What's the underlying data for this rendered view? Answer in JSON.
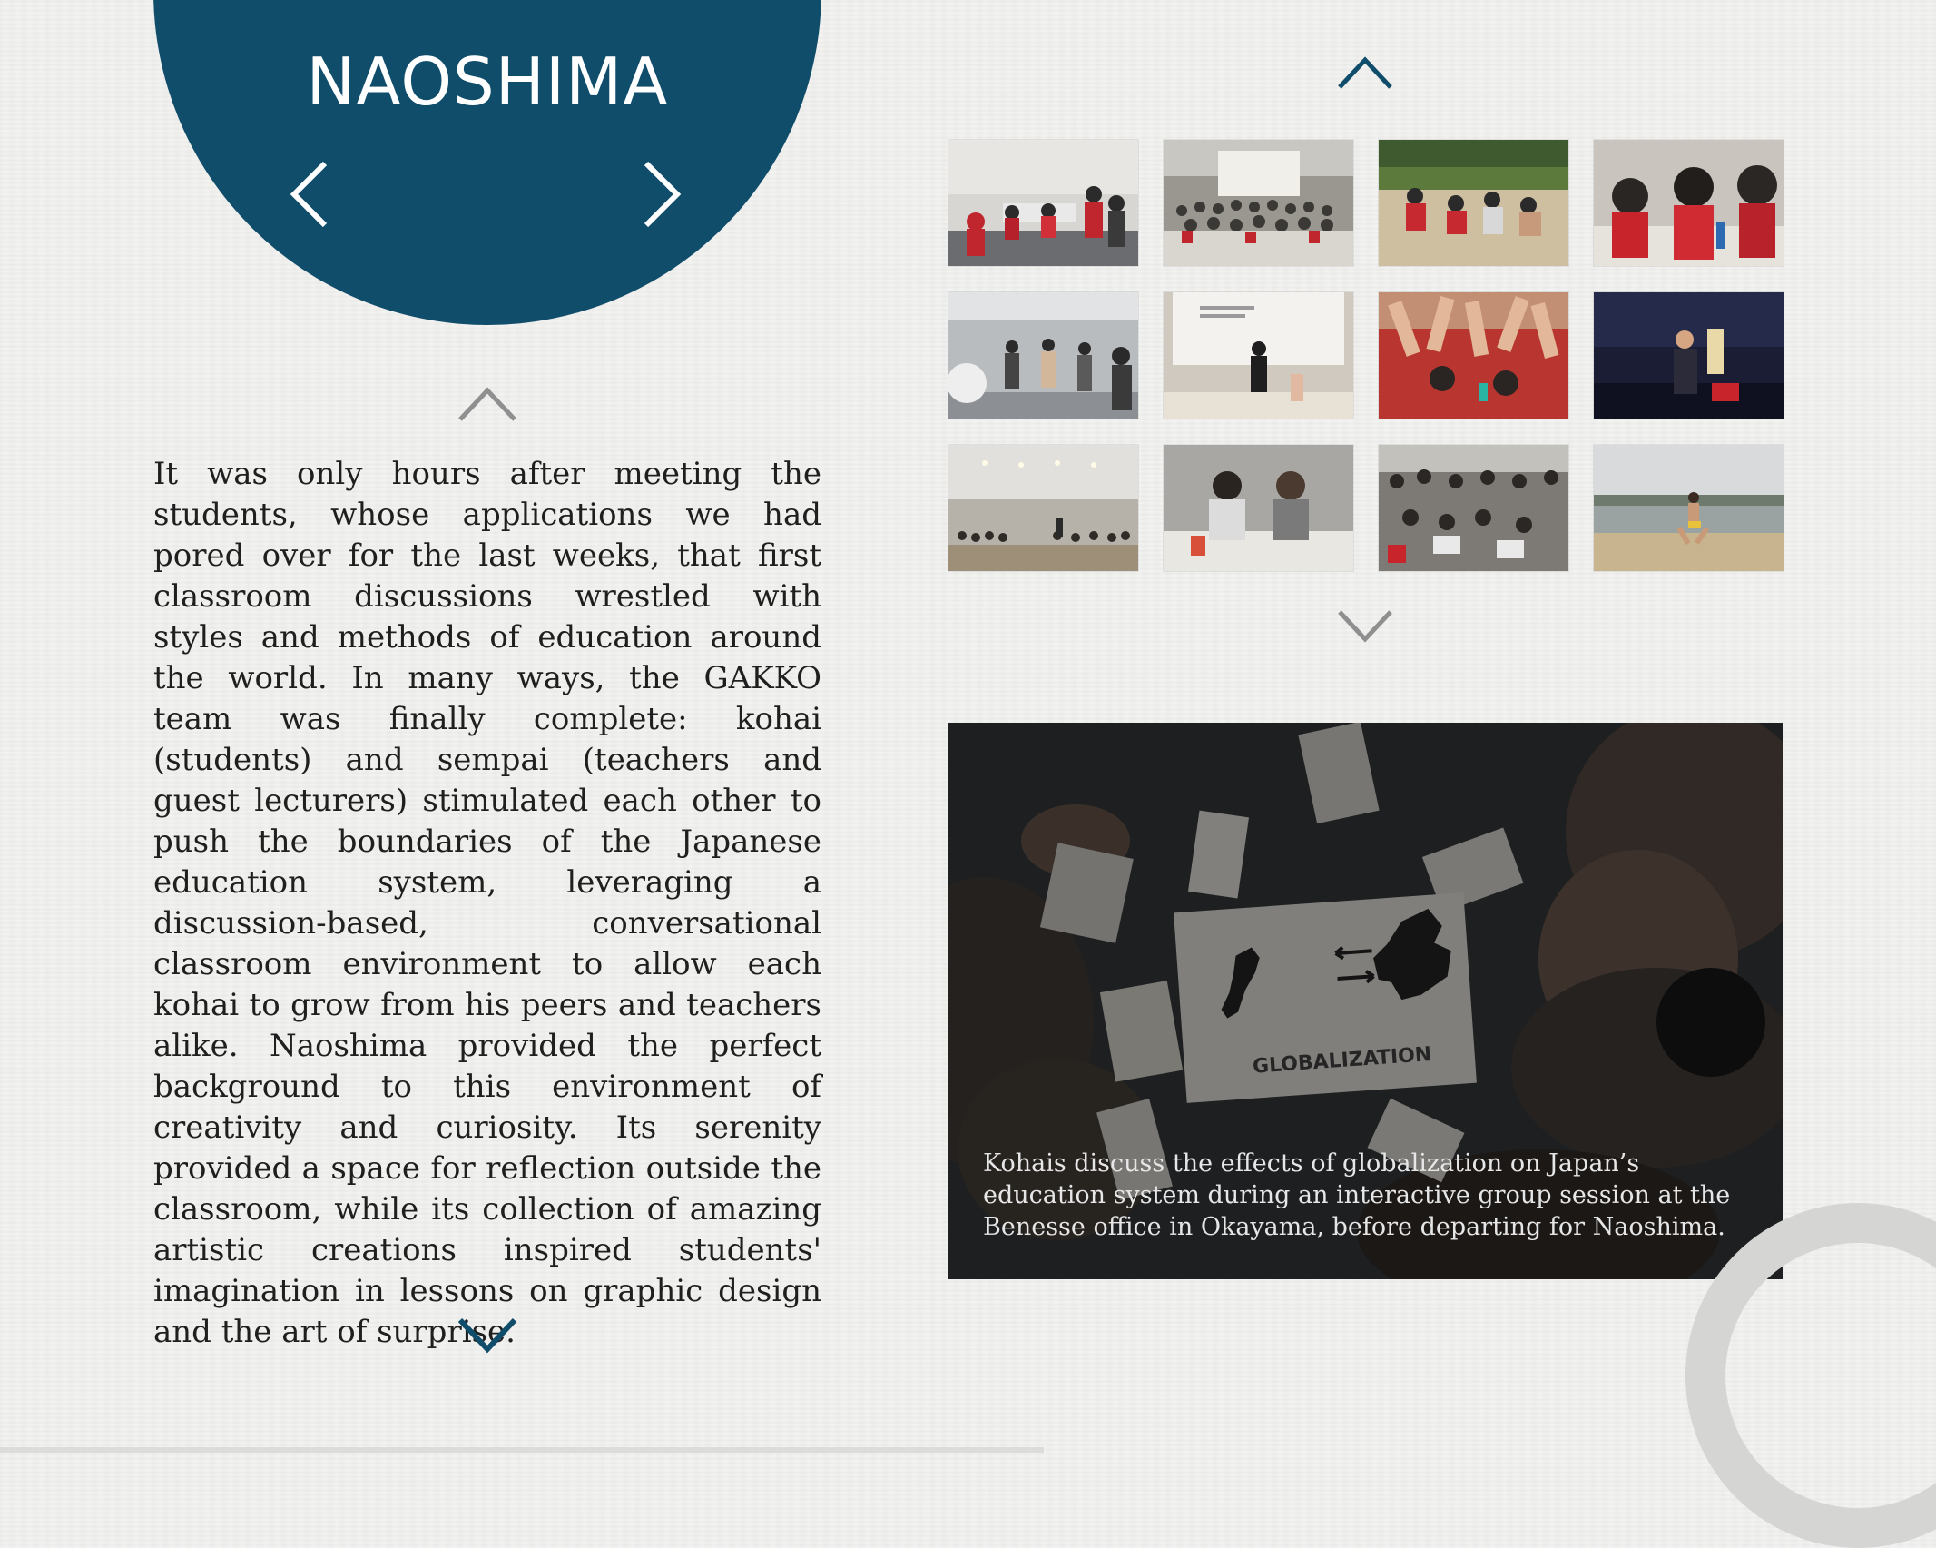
{
  "colors": {
    "accent": "#0f4d6b",
    "background": "#ececea",
    "text": "#1f1f1f",
    "muted_arrow": "#8a8a8a"
  },
  "header": {
    "title": "NAOSHIMA",
    "prev_icon": "chevron-left-icon",
    "next_icon": "chevron-right-icon"
  },
  "article": {
    "text": "It was only hours after meeting the students, whose applications we had pored over for the last weeks, that first classroom discussions wrestled with styles and methods of education around the world. In many ways, the GAKKO team was finally complete: kohai (students) and sempai (teachers and guest lecturers) stimulated each other to push the boundaries of the Japanese education system, leveraging a discussion-based, conversational classroom environment to allow each kohai to grow from his peers and teachers alike. Naoshima provided the perfect background to this environment of creativity and curiosity. Its serenity provided a space for reflection outside the classroom, while its collection of amazing artistic creations inspired students' imagination in lessons on graphic design and the art of surprise.",
    "scroll_up_icon": "chevron-up-icon",
    "scroll_down_icon": "chevron-down-icon"
  },
  "gallery": {
    "scroll_up_icon": "chevron-up-icon",
    "scroll_down_icon": "chevron-down-icon",
    "thumbnails": [
      {
        "scene": "classroom-workshop"
      },
      {
        "scene": "group-photo-lecture-hall"
      },
      {
        "scene": "beach-group-sitting"
      },
      {
        "scene": "students-laughing-table"
      },
      {
        "scene": "students-dancing-room"
      },
      {
        "scene": "speaker-presentation-screen"
      },
      {
        "scene": "raised-hands-red-shirts"
      },
      {
        "scene": "night-performance"
      },
      {
        "scene": "lecture-hall-audience"
      },
      {
        "scene": "two-students-discussion"
      },
      {
        "scene": "crowd-workshop"
      },
      {
        "scene": "runner-on-beach"
      }
    ]
  },
  "feature": {
    "sign_text": "GLOBALIZATION",
    "caption": "Kohais discuss the effects of globalization on Japan’s education system during an interactive group session at the Benesse office in Okayama, before departing for Naoshima."
  }
}
